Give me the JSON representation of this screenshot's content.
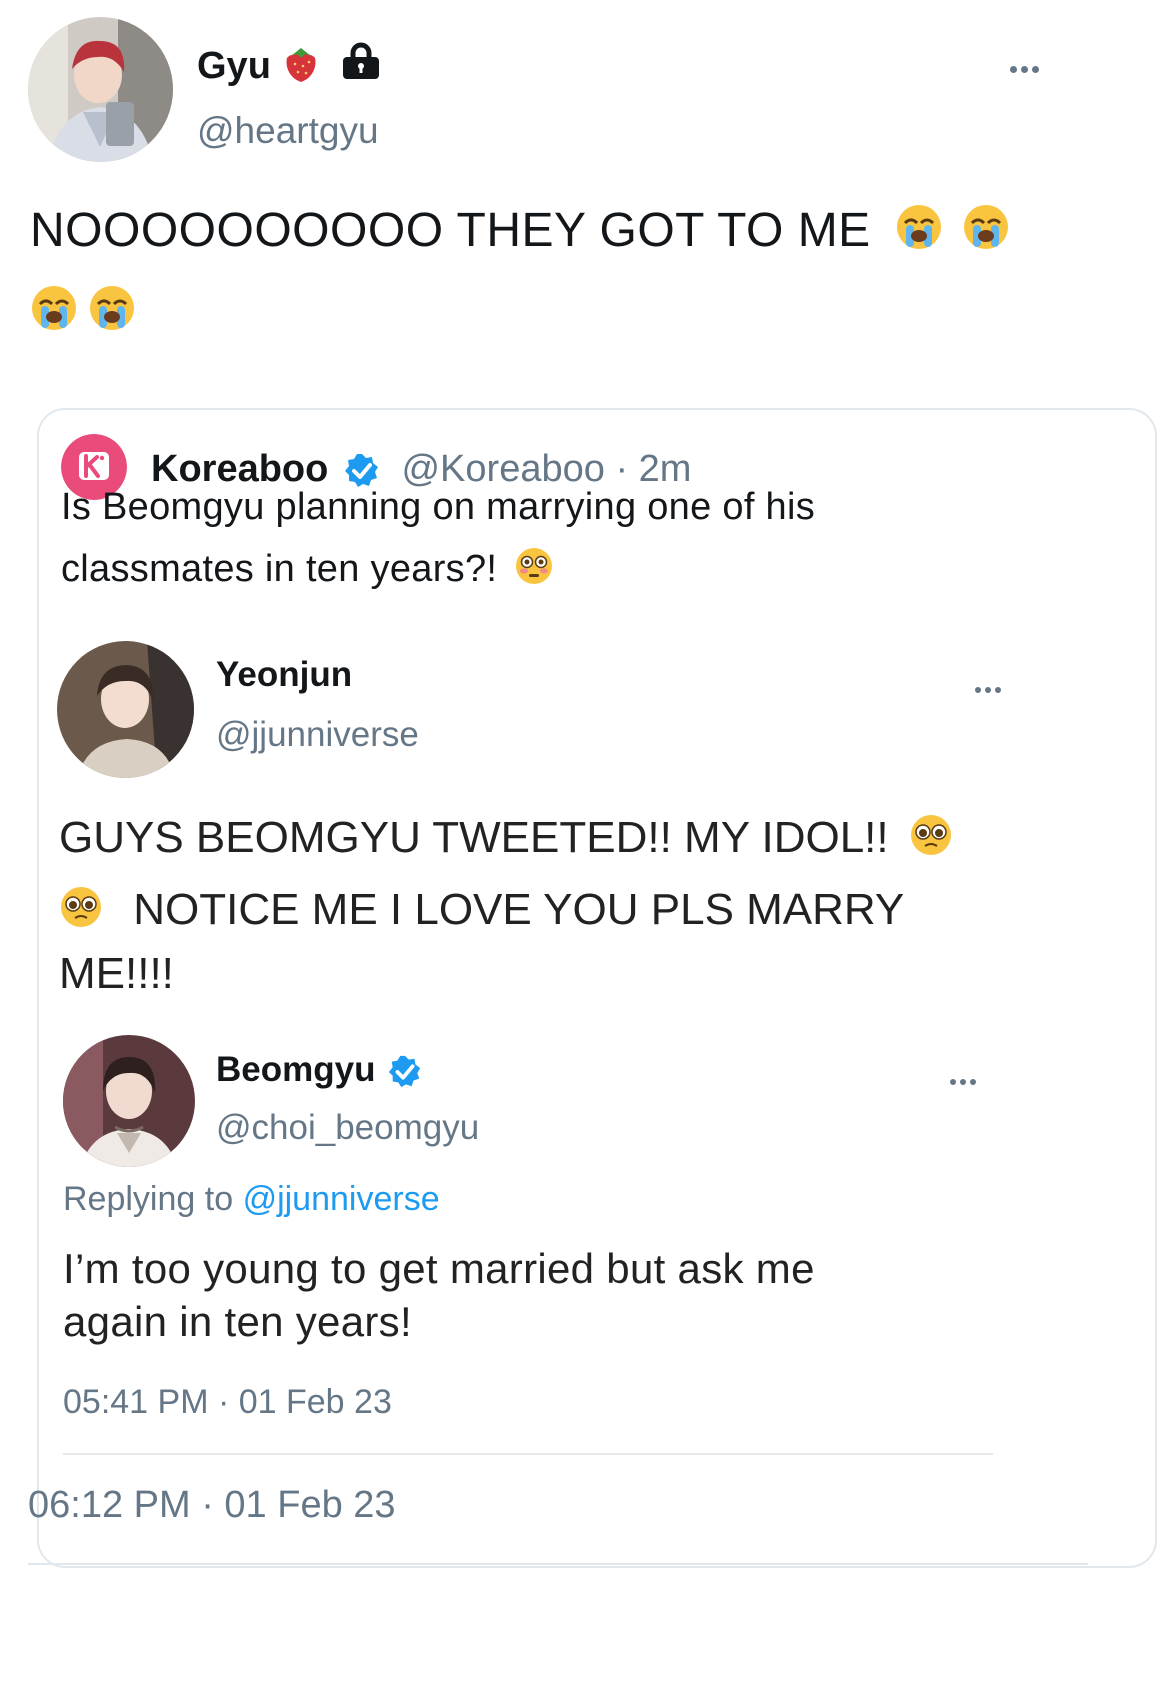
{
  "tweet": {
    "display_name": "Gyu",
    "name_emoji_icon": "strawberry-icon",
    "lock_icon": "lock-icon",
    "handle": "@heartgyu",
    "text_line1": "NOOOOOOOOOO THEY GOT TO ME",
    "emoji_icon": "loudly-crying-face-icon",
    "timestamp": "06:12 PM · 01 Feb 23"
  },
  "quote": {
    "display_name": "Koreaboo",
    "handle": "@Koreaboo",
    "time": "· 2m",
    "text_line1": "Is Beomgyu planning on marrying one of his",
    "text_line2": "classmates in ten years?!",
    "emoji_icon": "flushed-face-icon",
    "accent_color": "#e94b7b",
    "verified_color": "#1d9bf0"
  },
  "fan_tweet": {
    "display_name": "Yeonjun",
    "handle": "@jjunniverse",
    "text_line1": "GUYS BEOMGYU TWEETED!! MY IDOL!!",
    "text_line2": "NOTICE ME I LOVE YOU PLS MARRY",
    "text_line3": "ME!!!!",
    "emoji_icon": "pleading-face-icon"
  },
  "reply_tweet": {
    "display_name": "Beomgyu",
    "handle": "@choi_beomgyu",
    "replying_prefix": "Replying to",
    "replying_handle": "@jjunniverse",
    "text_line1": "I’m too young to get married but ask me",
    "text_line2": "again in ten years!",
    "timestamp": "05:41 PM · 01 Feb 23"
  }
}
